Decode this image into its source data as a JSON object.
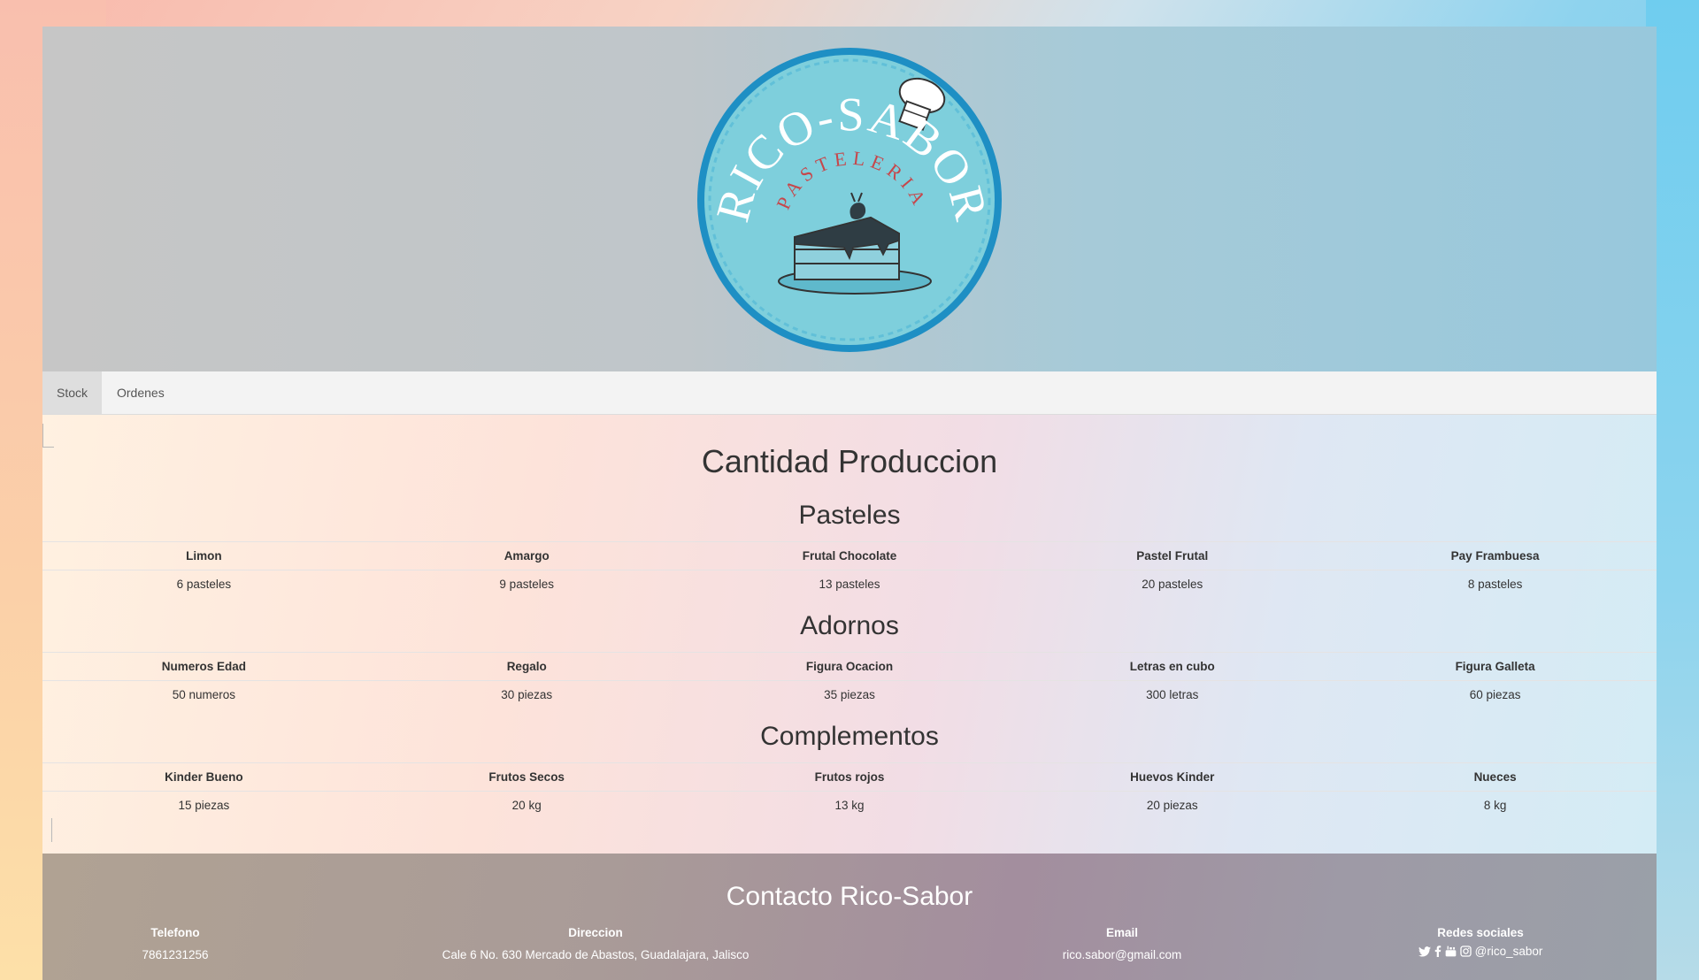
{
  "header": {
    "logo": {
      "title": "RICO-SABOR",
      "subtitle": "PASTELERIA"
    }
  },
  "nav": {
    "items": [
      {
        "label": "Stock",
        "active": true
      },
      {
        "label": "Ordenes",
        "active": false
      }
    ]
  },
  "main": {
    "title": "Cantidad Produccion",
    "sections": [
      {
        "title": "Pasteles",
        "headers": [
          "Limon",
          "Amargo",
          "Frutal Chocolate",
          "Pastel Frutal",
          "Pay Frambuesa"
        ],
        "values": [
          "6 pasteles",
          "9 pasteles",
          "13 pasteles",
          "20 pasteles",
          "8 pasteles"
        ]
      },
      {
        "title": "Adornos",
        "headers": [
          "Numeros Edad",
          "Regalo",
          "Figura Ocacion",
          "Letras en cubo",
          "Figura Galleta"
        ],
        "values": [
          "50 numeros",
          "30 piezas",
          "35 piezas",
          "300 letras",
          "60 piezas"
        ]
      },
      {
        "title": "Complementos",
        "headers": [
          "Kinder Bueno",
          "Frutos Secos",
          "Frutos rojos",
          "Huevos Kinder",
          "Nueces"
        ],
        "values": [
          "15 piezas",
          "20 kg",
          "13 kg",
          "20 piezas",
          "8 kg"
        ]
      }
    ]
  },
  "footer": {
    "title": "Contacto Rico-Sabor",
    "phone": {
      "label": "Telefono",
      "value": "7861231256"
    },
    "address": {
      "label": "Direccion",
      "value": "Cale 6 No. 630 Mercado de Abastos, Guadalajara, Jalisco"
    },
    "email": {
      "label": "Email",
      "value": "rico.sabor@gmail.com"
    },
    "social": {
      "label": "Redes sociales",
      "handle": "@rico_sabor",
      "icons": [
        "twitter-icon",
        "facebook-icon",
        "youtube-icon",
        "instagram-icon"
      ]
    }
  },
  "colors": {
    "logo_blue": "#1e8fc4",
    "logo_fill": "#7ecfdc",
    "logo_accent": "#c6474b"
  }
}
